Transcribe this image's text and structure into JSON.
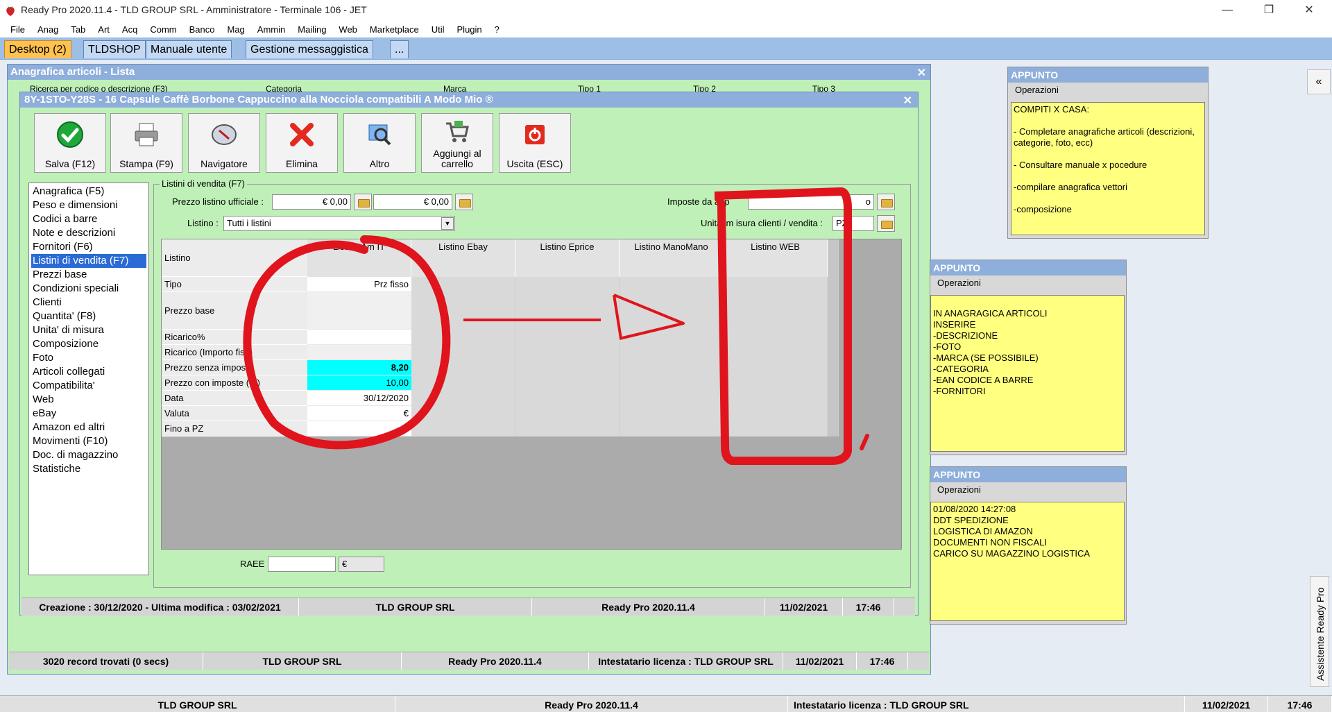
{
  "window": {
    "title": "Ready Pro 2020.11.4 - TLD GROUP SRL - Amministratore - Terminale 106 - JET"
  },
  "menu": [
    "File",
    "Anag",
    "Tab",
    "Art",
    "Acq",
    "Comm",
    "Banco",
    "Mag",
    "Ammin",
    "Mailing",
    "Web",
    "Marketplace",
    "Util",
    "Plugin",
    "?"
  ],
  "tabs": [
    "Desktop (2)",
    "TLDSHOP",
    "Manuale utente",
    "Gestione messaggistica",
    "..."
  ],
  "listwin": {
    "title": "Anagrafica articoli  - Lista",
    "search_labels": [
      "Ricerca per codice o descrizione (F3)",
      "Categoria",
      "Marca",
      "Tipo 1",
      "Tipo 2",
      "Tipo 3"
    ],
    "status": [
      "3020 record trovati (0 secs)",
      "TLD GROUP SRL",
      "Ready Pro 2020.11.4",
      "Intestatario licenza : TLD GROUP SRL",
      "11/02/2021",
      "17:46"
    ]
  },
  "artwin": {
    "title": "8Y-1STO-Y28S - 16 Capsule Caffè Borbone Cappuccino alla Nocciola compatibili A Modo Mio ®",
    "toolbar": [
      "Salva (F12)",
      "Stampa (F9)",
      "Navigatore",
      "Elimina",
      "Altro",
      "Aggiungi al carrello",
      "Uscita (ESC)"
    ],
    "nav": [
      "Anagrafica (F5)",
      "Peso e dimensioni",
      "Codici a barre",
      "Note e descrizioni",
      "Fornitori (F6)",
      "Listini di vendita (F7)",
      "Prezzi base",
      "Condizioni speciali",
      "Clienti",
      "Quantita' (F8)",
      "Unita' di misura",
      "Composizione",
      "Foto",
      "Articoli collegati",
      "Compatibilita'",
      "Web",
      "eBay",
      "Amazon ed altri",
      "Movimenti (F10)",
      "Doc. di magazzino",
      "Statistiche"
    ],
    "nav_selected": 5,
    "group_label": "Listini di vendita (F7)",
    "prezzo_listino_label": "Prezzo listino ufficiale :",
    "prezzo_1": "€ 0,00",
    "prezzo_2": "€ 0,00",
    "imposte_label": "Imposte da app",
    "imposte_value": "o",
    "listino_label": "Listino :",
    "listino_value": "Tutti i listini",
    "unita_label": "Unita' m",
    "unita_label_rest": "isura clienti / vendita :",
    "unita_value": "PZ",
    "grid": {
      "rows": [
        "Listino",
        "Tipo",
        "Prezzo base",
        "Ricarico%",
        "Ricarico (Importo fi",
        "Prezzo senza impost",
        "Prezzo con imposte (",
        "Data",
        "Valuta",
        "Fino a PZ"
      ],
      "row_tail_4": "so)",
      "row_tail_6": "%)",
      "columns": [
        "Listino Am",
        "Listino Ebay",
        "Listino Eprice",
        "Listino ManoMano",
        "Listino WEB"
      ],
      "col0_tail": "IT",
      "values": {
        "tipo": "Prz fisso",
        "prezzo_senza": "8,20",
        "prezzo_con": "10,00",
        "data": "30/12/2020",
        "valuta": "€"
      }
    },
    "raee_label": "RAEE :",
    "raee_currency": "€",
    "status": [
      "Creazione : 30/12/2020 - Ultima modifica : 03/02/2021",
      "TLD GROUP SRL",
      "Ready Pro 2020.11.4",
      "11/02/2021",
      "17:46"
    ]
  },
  "notes": [
    {
      "title": "APPUNTO",
      "ops": "Operazioni",
      "body": "COMPITI X CASA:\n\n- Completare anagrafiche articoli (descrizioni, categorie, foto, ecc)\n\n- Consultare manuale x pocedure\n\n-compilare anagrafica vettori\n\n-composizione"
    },
    {
      "title": "APPUNTO",
      "ops": "Operazioni",
      "body": "IN ANAGRAGICA ARTICOLI\nINSERIRE\n-DESCRIZIONE\n-FOTO\n-MARCA (SE POSSIBILE)\n-CATEGORIA\n-EAN CODICE A BARRE\n-FORNITORI"
    },
    {
      "title": "APPUNTO",
      "ops": "Operazioni",
      "body": "01/08/2020 14:27:08\nDDT SPEDIZIONE\nLOGISTICA DI AMAZON\nDOCUMENTI NON FISCALI\nCARICO SU MAGAZZINO LOGISTICA"
    }
  ],
  "assistant_label": "Assistente Ready Pro",
  "collapse_label": "«",
  "bottom_status": [
    "TLD GROUP SRL",
    "Ready Pro 2020.11.4",
    "Intestatario licenza : TLD GROUP SRL",
    "11/02/2021",
    "17:46"
  ],
  "colors": {
    "accent_tab": "#ffc14f",
    "titlebar": "#8eaedb",
    "panel_bg": "#bff0b8",
    "note_bg": "#ffff80",
    "cyan": "#00ffff",
    "annotation_red": "#e0141c"
  }
}
